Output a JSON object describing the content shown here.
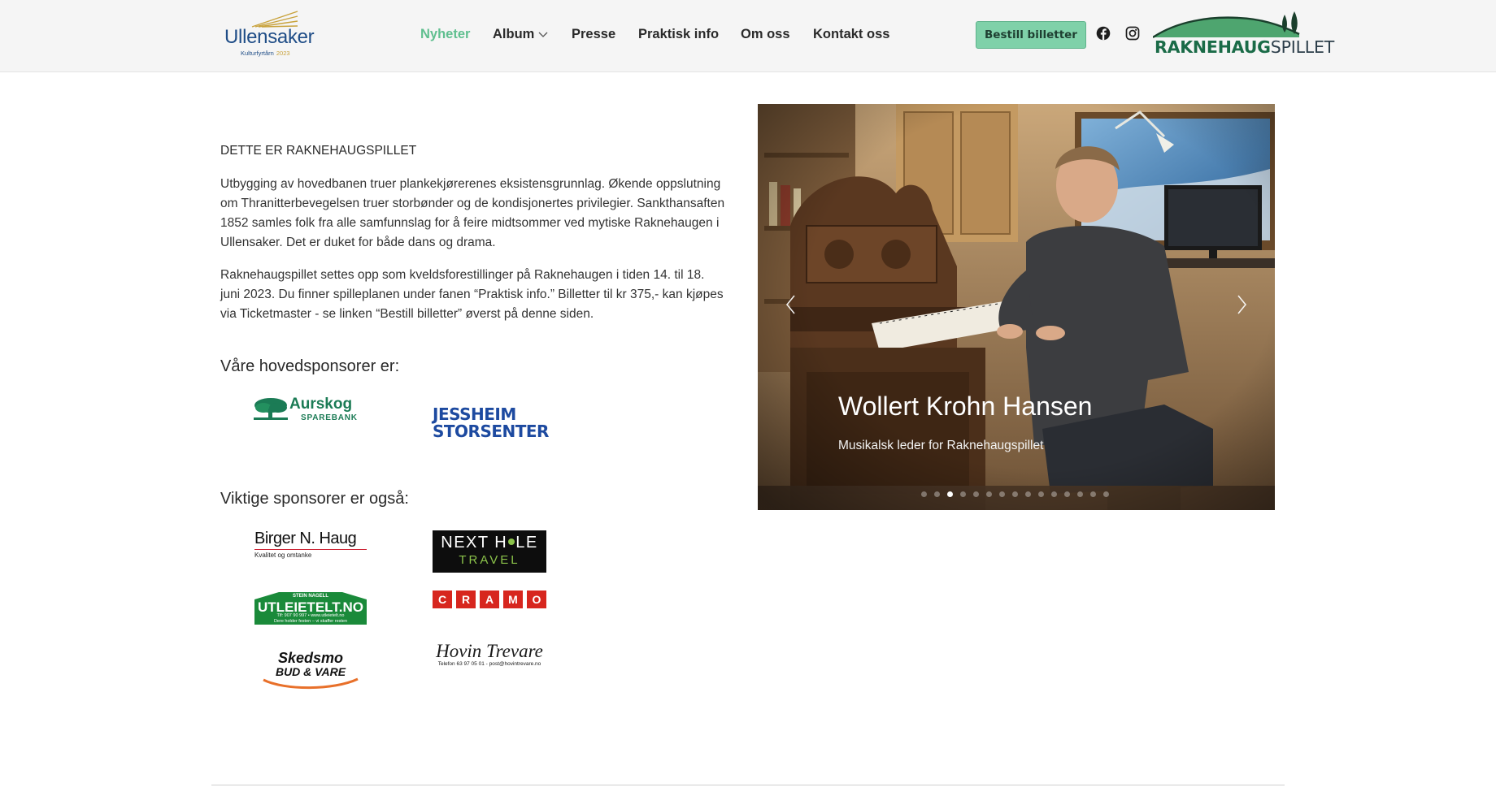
{
  "header": {
    "left_logo": {
      "name": "Ullensaker",
      "subtitle": "Kulturfyrtårn",
      "year": "2023"
    },
    "nav": [
      {
        "label": "Nyheter",
        "active": true
      },
      {
        "label": "Album",
        "has_dropdown": true
      },
      {
        "label": "Presse"
      },
      {
        "label": "Praktisk info"
      },
      {
        "label": "Om oss"
      },
      {
        "label": "Kontakt oss"
      }
    ],
    "book_button": "Bestill billetter",
    "social": [
      "facebook-icon",
      "instagram-icon"
    ],
    "right_logo": {
      "part1": "RAKNEHAUG",
      "part2": "SPILLET"
    }
  },
  "content": {
    "intro": "DETTE ER RAKNEHAUGSPILLET",
    "paragraph1": "Utbygging av hovedbanen truer plankekjørerenes eksistensgrunnlag. Økende oppslutning om Thranitterbevegelsen truer storbønder og de kondisjonertes privilegier. Sankthansaften 1852 samles folk fra alle samfunnslag for å feire midtsommer ved mytiske Raknehaugen i Ullensaker. Det er duket for både dans og drama.",
    "paragraph2": "Raknehaugspillet settes opp som kveldsforestillinger på Raknehaugen i tiden 14. til 18. juni 2023. Du finner spilleplanen under fanen “Praktisk info.” Billetter til kr 375,- kan kjøpes via Ticketmaster - se linken “Bestill billetter” øverst på denne siden.",
    "main_sponsors_heading": "Våre hovedsponsorer er:",
    "main_sponsors": [
      {
        "name": "Aurskog",
        "sub": "SPAREBANK"
      },
      {
        "line1": "JESSHEIM",
        "line2": "STORSENTER"
      }
    ],
    "other_sponsors_heading": "Viktige sponsorer er også:",
    "other_sponsors": {
      "birger": {
        "name": "Birger N. Haug",
        "tagline": "Kvalitet og omtanke"
      },
      "nexthole": {
        "line1a": "NEXT H",
        "line1b": "LE",
        "line2": "TRAVEL"
      },
      "utleie": {
        "top": "STEIN NAGELL",
        "main": "UTLEIETELT.NO",
        "phone": "Tlf: 907 90 997 • www.utleietelt.no",
        "tagline": "Dere holder festen – vi skaffer resten"
      },
      "cramo": {
        "letters": [
          "C",
          "R",
          "A",
          "M",
          "O"
        ]
      },
      "skedsmo": {
        "line1": "Skedsmo",
        "line2": "BUD & VARE"
      },
      "hovin": {
        "name": "Hovin Trevare",
        "contact": "Telefon 63 97 05 01 - post@hovintrevare.no"
      }
    }
  },
  "carousel": {
    "caption_title": "Wollert Krohn Hansen",
    "caption_subtitle": "Musikalsk leder for Raknehaugspillet",
    "slide_count": 15,
    "active_index": 2
  },
  "colors": {
    "accent": "#5fbf8f",
    "button": "#7fd1a9",
    "brand_dark": "#1a6b47",
    "ullensaker_blue": "#1f4d87"
  }
}
